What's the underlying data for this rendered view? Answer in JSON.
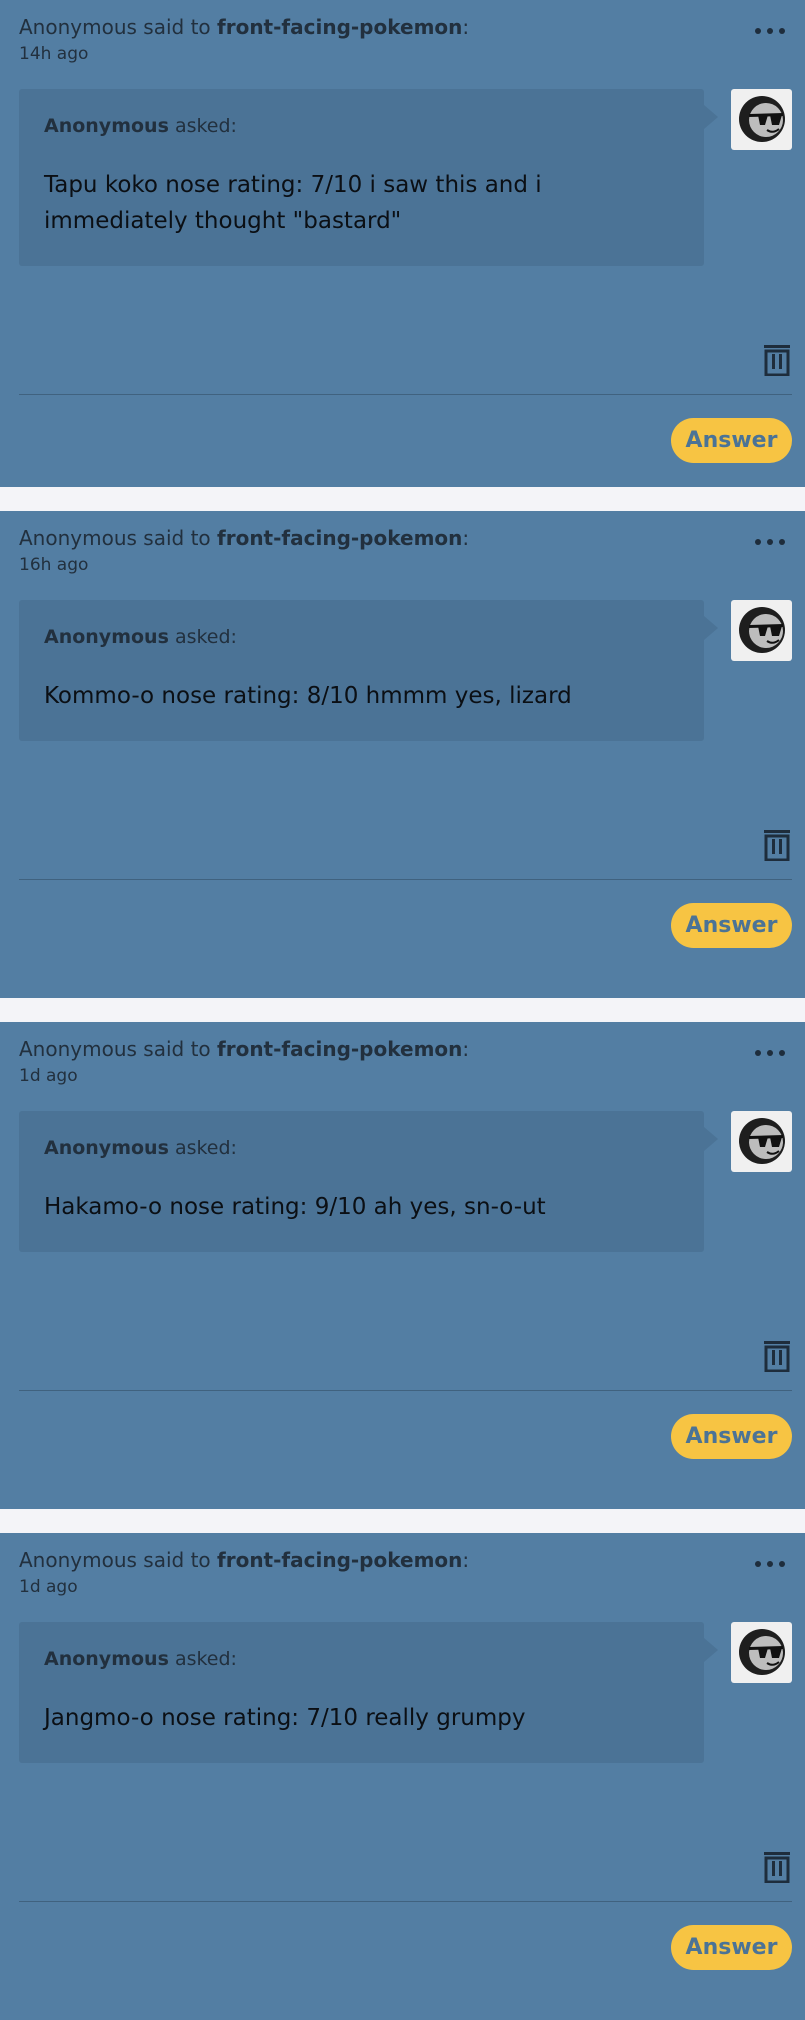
{
  "colors": {
    "card_background": "#537ea3",
    "bubble_background": "#4b7396",
    "answer_button": "#f7c443",
    "answer_text": "#4b7396",
    "page_background": "#f4f4f8"
  },
  "icons": {
    "more": "ellipsis-icon",
    "avatar": "sunglasses-face-icon",
    "delete": "trash-icon"
  },
  "posts": [
    {
      "sender": "Anonymous",
      "said_to": "said to",
      "blog": "front-facing-pokemon",
      "colon": ":",
      "time": "14h ago",
      "asker": "Anonymous",
      "asked": "asked:",
      "question": "Tapu koko nose rating: 7/10 i saw this and i immediately thought \"bastard\"",
      "answer_label": "Answer"
    },
    {
      "sender": "Anonymous",
      "said_to": "said to",
      "blog": "front-facing-pokemon",
      "colon": ":",
      "time": "16h ago",
      "asker": "Anonymous",
      "asked": "asked:",
      "question": "Kommo-o nose rating: 8/10 hmmm yes, lizard",
      "answer_label": "Answer"
    },
    {
      "sender": "Anonymous",
      "said_to": "said to",
      "blog": "front-facing-pokemon",
      "colon": ":",
      "time": "1d ago",
      "asker": "Anonymous",
      "asked": "asked:",
      "question": "Hakamo-o nose rating: 9/10 ah yes, sn-o-ut",
      "answer_label": "Answer"
    },
    {
      "sender": "Anonymous",
      "said_to": "said to",
      "blog": "front-facing-pokemon",
      "colon": ":",
      "time": "1d ago",
      "asker": "Anonymous",
      "asked": "asked:",
      "question": "Jangmo-o nose rating: 7/10 really grumpy",
      "answer_label": "Answer"
    }
  ]
}
